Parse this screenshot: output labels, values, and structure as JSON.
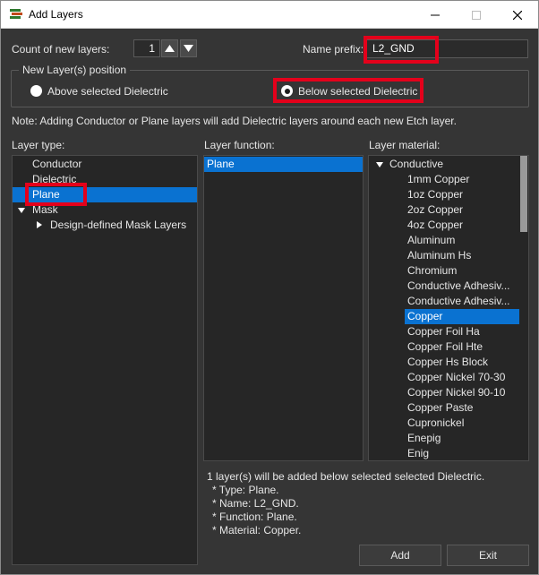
{
  "window": {
    "title": "Add Layers",
    "controls": {
      "minimize": "—",
      "maximize": "☐",
      "close": "✕"
    }
  },
  "count": {
    "label": "Count of new layers:",
    "value": "1"
  },
  "prefix": {
    "label": "Name prefix:",
    "value": "L2_GND"
  },
  "position": {
    "title": "New Layer(s) position",
    "options": [
      "Above selected Dielectric",
      "Below selected Dielectric"
    ],
    "selected": "Below selected Dielectric"
  },
  "note": "Note: Adding Conductor or Plane layers will add Dielectric layers around each new Etch layer.",
  "layer_type": {
    "header": "Layer type:",
    "items": [
      "Conductor",
      "Dielectric",
      "Plane",
      "Mask",
      "Design-defined Mask Layers"
    ],
    "selected": "Plane"
  },
  "layer_function": {
    "header": "Layer function:",
    "items": [
      "Plane"
    ],
    "selected": "Plane"
  },
  "layer_material": {
    "header": "Layer material:",
    "group": "Conductive",
    "items": [
      "1mm Copper",
      "1oz Copper",
      "2oz Copper",
      "4oz Copper",
      "Aluminum",
      "Aluminum Hs",
      "Chromium",
      "Conductive Adhesiv...",
      "Conductive Adhesiv...",
      "Copper",
      "Copper Foil Ha",
      "Copper Foil Hte",
      "Copper Hs Block",
      "Copper Nickel 70-30",
      "Copper Nickel 90-10",
      "Copper Paste",
      "Cupronickel",
      "Enepig",
      "Enig"
    ],
    "selected": "Copper"
  },
  "summary": [
    "1 layer(s) will be added below selected selected Dielectric.",
    "* Type: Plane.",
    "* Name: L2_GND.",
    "* Function: Plane.",
    "* Material: Copper."
  ],
  "buttons": {
    "add": "Add",
    "exit": "Exit"
  },
  "colors": {
    "selection": "#0a72d1",
    "highlight": "#e4001b",
    "background": "#353535",
    "panel": "#262626"
  }
}
